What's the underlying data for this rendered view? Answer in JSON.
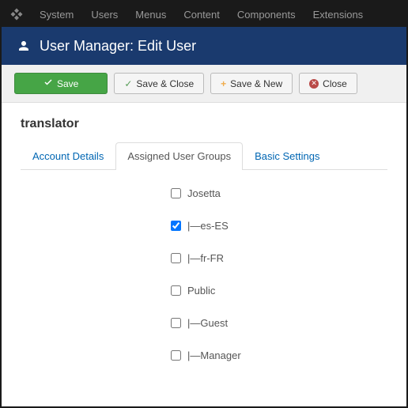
{
  "topbar": {
    "items": [
      "System",
      "Users",
      "Menus",
      "Content",
      "Components",
      "Extensions"
    ]
  },
  "header": {
    "title": "User Manager: Edit User"
  },
  "toolbar": {
    "save": "Save",
    "save_close": "Save & Close",
    "save_new": "Save & New",
    "close": "Close"
  },
  "page_title": "translator",
  "tabs": [
    {
      "label": "Account Details",
      "active": false
    },
    {
      "label": "Assigned User Groups",
      "active": true
    },
    {
      "label": "Basic Settings",
      "active": false
    }
  ],
  "groups": [
    {
      "label": "Josetta",
      "checked": false
    },
    {
      "label": "|—es-ES",
      "checked": true
    },
    {
      "label": "|—fr-FR",
      "checked": false
    },
    {
      "label": "Public",
      "checked": false
    },
    {
      "label": "|—Guest",
      "checked": false
    },
    {
      "label": "|—Manager",
      "checked": false
    }
  ]
}
